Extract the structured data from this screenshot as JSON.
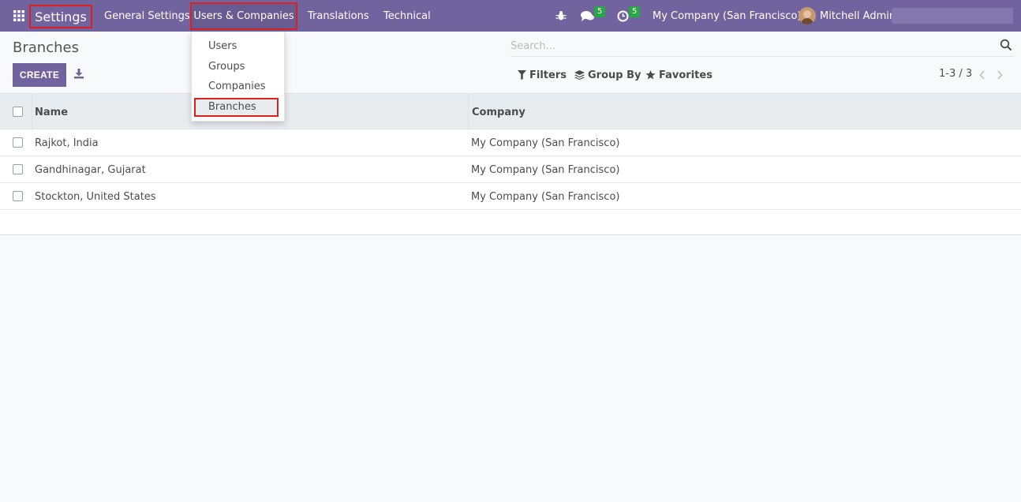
{
  "navbar": {
    "brand": "Settings",
    "menu": [
      "General Settings",
      "Users & Companies",
      "Translations",
      "Technical"
    ],
    "messages_badge": "5",
    "activities_badge": "5",
    "company": "My Company (San Francisco)",
    "user": "Mitchell Admin"
  },
  "dropdown": {
    "items": [
      "Users",
      "Groups",
      "Companies",
      "Branches"
    ]
  },
  "control_panel": {
    "title": "Branches",
    "create_label": "CREATE",
    "search_placeholder": "Search...",
    "filters_label": "Filters",
    "groupby_label": "Group By",
    "favorites_label": "Favorites",
    "pager": "1-3 / 3"
  },
  "table": {
    "columns": [
      "Name",
      "Company"
    ],
    "rows": [
      {
        "name": "Rajkot, India",
        "company": "My Company (San Francisco)"
      },
      {
        "name": "Gandhinagar, Gujarat",
        "company": "My Company (San Francisco)"
      },
      {
        "name": "Stockton, United States",
        "company": "My Company (San Francisco)"
      }
    ]
  },
  "colors": {
    "navbar": "#71639e",
    "highlight_border": "#d9211d",
    "badge": "#28a745"
  }
}
